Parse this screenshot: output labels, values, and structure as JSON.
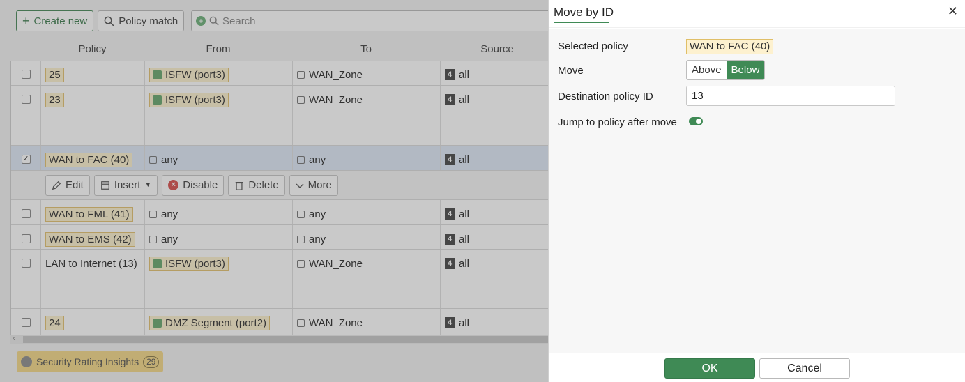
{
  "toolbar": {
    "create_label": "Create new",
    "policy_match_label": "Policy match",
    "search_placeholder": "Search"
  },
  "table": {
    "columns": [
      "Policy",
      "From",
      "To",
      "Source"
    ],
    "rows": [
      {
        "policy": "25",
        "from": "ISFW (port3)",
        "to": "WAN_Zone",
        "source": "all"
      },
      {
        "policy": "23",
        "from": "ISFW (port3)",
        "to": "WAN_Zone",
        "source": "all"
      },
      {
        "policy": "WAN to FAC (40)",
        "from": "any",
        "to": "any",
        "source": "all"
      },
      {
        "policy": "WAN to FML (41)",
        "from": "any",
        "to": "any",
        "source": "all"
      },
      {
        "policy": "WAN to EMS (42)",
        "from": "any",
        "to": "any",
        "source": "all"
      },
      {
        "policy": "LAN to Internet (13)",
        "from": "ISFW (port3)",
        "to": "WAN_Zone",
        "source": "all"
      },
      {
        "policy": "24",
        "from": "DMZ Segment (port2)",
        "to": "WAN_Zone",
        "source": "all"
      }
    ],
    "source_badge": "4"
  },
  "actions": {
    "edit": "Edit",
    "insert": "Insert",
    "disable": "Disable",
    "delete": "Delete",
    "more": "More"
  },
  "insights": {
    "label": "Security Rating Insights",
    "count": "29"
  },
  "dialog": {
    "title": "Move by ID",
    "selected_policy_label": "Selected policy",
    "selected_policy_value": "WAN to FAC (40)",
    "move_label": "Move",
    "move_options": [
      "Above",
      "Below"
    ],
    "move_selected": "Below",
    "destination_label": "Destination policy ID",
    "destination_value": "13",
    "jump_label": "Jump to policy after move",
    "jump_enabled": true,
    "ok_label": "OK",
    "cancel_label": "Cancel"
  },
  "colors": {
    "accent_green": "#3f8a55",
    "pill_yellow": "#fdf1cf"
  }
}
